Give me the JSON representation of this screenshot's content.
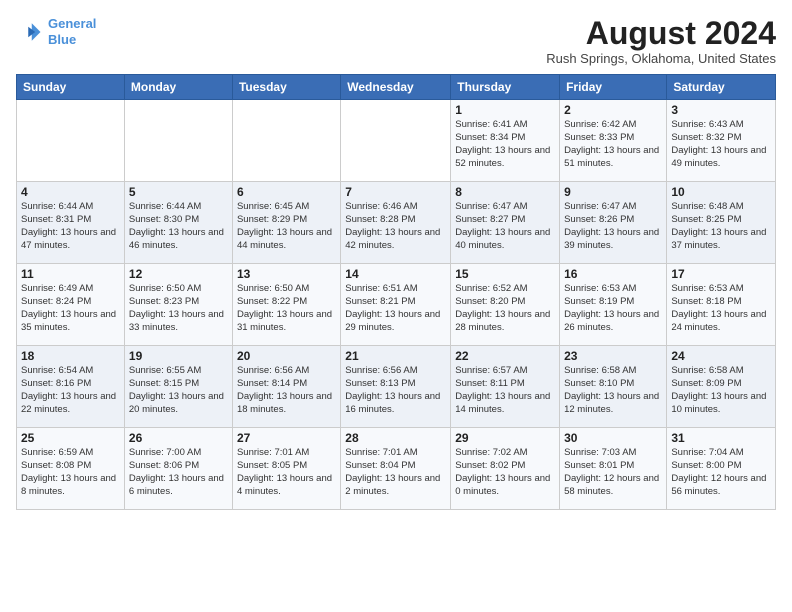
{
  "logo": {
    "line1": "General",
    "line2": "Blue"
  },
  "title": "August 2024",
  "location": "Rush Springs, Oklahoma, United States",
  "days_of_week": [
    "Sunday",
    "Monday",
    "Tuesday",
    "Wednesday",
    "Thursday",
    "Friday",
    "Saturday"
  ],
  "weeks": [
    [
      {
        "day": "",
        "content": ""
      },
      {
        "day": "",
        "content": ""
      },
      {
        "day": "",
        "content": ""
      },
      {
        "day": "",
        "content": ""
      },
      {
        "day": "1",
        "content": "Sunrise: 6:41 AM\nSunset: 8:34 PM\nDaylight: 13 hours\nand 52 minutes."
      },
      {
        "day": "2",
        "content": "Sunrise: 6:42 AM\nSunset: 8:33 PM\nDaylight: 13 hours\nand 51 minutes."
      },
      {
        "day": "3",
        "content": "Sunrise: 6:43 AM\nSunset: 8:32 PM\nDaylight: 13 hours\nand 49 minutes."
      }
    ],
    [
      {
        "day": "4",
        "content": "Sunrise: 6:44 AM\nSunset: 8:31 PM\nDaylight: 13 hours\nand 47 minutes."
      },
      {
        "day": "5",
        "content": "Sunrise: 6:44 AM\nSunset: 8:30 PM\nDaylight: 13 hours\nand 46 minutes."
      },
      {
        "day": "6",
        "content": "Sunrise: 6:45 AM\nSunset: 8:29 PM\nDaylight: 13 hours\nand 44 minutes."
      },
      {
        "day": "7",
        "content": "Sunrise: 6:46 AM\nSunset: 8:28 PM\nDaylight: 13 hours\nand 42 minutes."
      },
      {
        "day": "8",
        "content": "Sunrise: 6:47 AM\nSunset: 8:27 PM\nDaylight: 13 hours\nand 40 minutes."
      },
      {
        "day": "9",
        "content": "Sunrise: 6:47 AM\nSunset: 8:26 PM\nDaylight: 13 hours\nand 39 minutes."
      },
      {
        "day": "10",
        "content": "Sunrise: 6:48 AM\nSunset: 8:25 PM\nDaylight: 13 hours\nand 37 minutes."
      }
    ],
    [
      {
        "day": "11",
        "content": "Sunrise: 6:49 AM\nSunset: 8:24 PM\nDaylight: 13 hours\nand 35 minutes."
      },
      {
        "day": "12",
        "content": "Sunrise: 6:50 AM\nSunset: 8:23 PM\nDaylight: 13 hours\nand 33 minutes."
      },
      {
        "day": "13",
        "content": "Sunrise: 6:50 AM\nSunset: 8:22 PM\nDaylight: 13 hours\nand 31 minutes."
      },
      {
        "day": "14",
        "content": "Sunrise: 6:51 AM\nSunset: 8:21 PM\nDaylight: 13 hours\nand 29 minutes."
      },
      {
        "day": "15",
        "content": "Sunrise: 6:52 AM\nSunset: 8:20 PM\nDaylight: 13 hours\nand 28 minutes."
      },
      {
        "day": "16",
        "content": "Sunrise: 6:53 AM\nSunset: 8:19 PM\nDaylight: 13 hours\nand 26 minutes."
      },
      {
        "day": "17",
        "content": "Sunrise: 6:53 AM\nSunset: 8:18 PM\nDaylight: 13 hours\nand 24 minutes."
      }
    ],
    [
      {
        "day": "18",
        "content": "Sunrise: 6:54 AM\nSunset: 8:16 PM\nDaylight: 13 hours\nand 22 minutes."
      },
      {
        "day": "19",
        "content": "Sunrise: 6:55 AM\nSunset: 8:15 PM\nDaylight: 13 hours\nand 20 minutes."
      },
      {
        "day": "20",
        "content": "Sunrise: 6:56 AM\nSunset: 8:14 PM\nDaylight: 13 hours\nand 18 minutes."
      },
      {
        "day": "21",
        "content": "Sunrise: 6:56 AM\nSunset: 8:13 PM\nDaylight: 13 hours\nand 16 minutes."
      },
      {
        "day": "22",
        "content": "Sunrise: 6:57 AM\nSunset: 8:11 PM\nDaylight: 13 hours\nand 14 minutes."
      },
      {
        "day": "23",
        "content": "Sunrise: 6:58 AM\nSunset: 8:10 PM\nDaylight: 13 hours\nand 12 minutes."
      },
      {
        "day": "24",
        "content": "Sunrise: 6:58 AM\nSunset: 8:09 PM\nDaylight: 13 hours\nand 10 minutes."
      }
    ],
    [
      {
        "day": "25",
        "content": "Sunrise: 6:59 AM\nSunset: 8:08 PM\nDaylight: 13 hours\nand 8 minutes."
      },
      {
        "day": "26",
        "content": "Sunrise: 7:00 AM\nSunset: 8:06 PM\nDaylight: 13 hours\nand 6 minutes."
      },
      {
        "day": "27",
        "content": "Sunrise: 7:01 AM\nSunset: 8:05 PM\nDaylight: 13 hours\nand 4 minutes."
      },
      {
        "day": "28",
        "content": "Sunrise: 7:01 AM\nSunset: 8:04 PM\nDaylight: 13 hours\nand 2 minutes."
      },
      {
        "day": "29",
        "content": "Sunrise: 7:02 AM\nSunset: 8:02 PM\nDaylight: 13 hours\nand 0 minutes."
      },
      {
        "day": "30",
        "content": "Sunrise: 7:03 AM\nSunset: 8:01 PM\nDaylight: 12 hours\nand 58 minutes."
      },
      {
        "day": "31",
        "content": "Sunrise: 7:04 AM\nSunset: 8:00 PM\nDaylight: 12 hours\nand 56 minutes."
      }
    ]
  ]
}
